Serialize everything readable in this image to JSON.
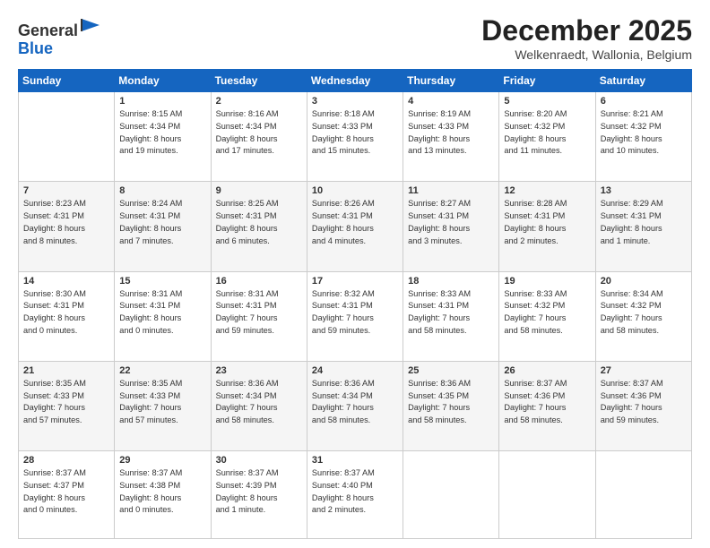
{
  "header": {
    "logo_line1": "General",
    "logo_line2": "Blue",
    "month": "December 2025",
    "location": "Welkenraedt, Wallonia, Belgium"
  },
  "weekdays": [
    "Sunday",
    "Monday",
    "Tuesday",
    "Wednesday",
    "Thursday",
    "Friday",
    "Saturday"
  ],
  "weeks": [
    [
      {
        "day": "",
        "info": ""
      },
      {
        "day": "1",
        "info": "Sunrise: 8:15 AM\nSunset: 4:34 PM\nDaylight: 8 hours\nand 19 minutes."
      },
      {
        "day": "2",
        "info": "Sunrise: 8:16 AM\nSunset: 4:34 PM\nDaylight: 8 hours\nand 17 minutes."
      },
      {
        "day": "3",
        "info": "Sunrise: 8:18 AM\nSunset: 4:33 PM\nDaylight: 8 hours\nand 15 minutes."
      },
      {
        "day": "4",
        "info": "Sunrise: 8:19 AM\nSunset: 4:33 PM\nDaylight: 8 hours\nand 13 minutes."
      },
      {
        "day": "5",
        "info": "Sunrise: 8:20 AM\nSunset: 4:32 PM\nDaylight: 8 hours\nand 11 minutes."
      },
      {
        "day": "6",
        "info": "Sunrise: 8:21 AM\nSunset: 4:32 PM\nDaylight: 8 hours\nand 10 minutes."
      }
    ],
    [
      {
        "day": "7",
        "info": "Sunrise: 8:23 AM\nSunset: 4:31 PM\nDaylight: 8 hours\nand 8 minutes."
      },
      {
        "day": "8",
        "info": "Sunrise: 8:24 AM\nSunset: 4:31 PM\nDaylight: 8 hours\nand 7 minutes."
      },
      {
        "day": "9",
        "info": "Sunrise: 8:25 AM\nSunset: 4:31 PM\nDaylight: 8 hours\nand 6 minutes."
      },
      {
        "day": "10",
        "info": "Sunrise: 8:26 AM\nSunset: 4:31 PM\nDaylight: 8 hours\nand 4 minutes."
      },
      {
        "day": "11",
        "info": "Sunrise: 8:27 AM\nSunset: 4:31 PM\nDaylight: 8 hours\nand 3 minutes."
      },
      {
        "day": "12",
        "info": "Sunrise: 8:28 AM\nSunset: 4:31 PM\nDaylight: 8 hours\nand 2 minutes."
      },
      {
        "day": "13",
        "info": "Sunrise: 8:29 AM\nSunset: 4:31 PM\nDaylight: 8 hours\nand 1 minute."
      }
    ],
    [
      {
        "day": "14",
        "info": "Sunrise: 8:30 AM\nSunset: 4:31 PM\nDaylight: 8 hours\nand 0 minutes."
      },
      {
        "day": "15",
        "info": "Sunrise: 8:31 AM\nSunset: 4:31 PM\nDaylight: 8 hours\nand 0 minutes."
      },
      {
        "day": "16",
        "info": "Sunrise: 8:31 AM\nSunset: 4:31 PM\nDaylight: 7 hours\nand 59 minutes."
      },
      {
        "day": "17",
        "info": "Sunrise: 8:32 AM\nSunset: 4:31 PM\nDaylight: 7 hours\nand 59 minutes."
      },
      {
        "day": "18",
        "info": "Sunrise: 8:33 AM\nSunset: 4:31 PM\nDaylight: 7 hours\nand 58 minutes."
      },
      {
        "day": "19",
        "info": "Sunrise: 8:33 AM\nSunset: 4:32 PM\nDaylight: 7 hours\nand 58 minutes."
      },
      {
        "day": "20",
        "info": "Sunrise: 8:34 AM\nSunset: 4:32 PM\nDaylight: 7 hours\nand 58 minutes."
      }
    ],
    [
      {
        "day": "21",
        "info": "Sunrise: 8:35 AM\nSunset: 4:33 PM\nDaylight: 7 hours\nand 57 minutes."
      },
      {
        "day": "22",
        "info": "Sunrise: 8:35 AM\nSunset: 4:33 PM\nDaylight: 7 hours\nand 57 minutes."
      },
      {
        "day": "23",
        "info": "Sunrise: 8:36 AM\nSunset: 4:34 PM\nDaylight: 7 hours\nand 58 minutes."
      },
      {
        "day": "24",
        "info": "Sunrise: 8:36 AM\nSunset: 4:34 PM\nDaylight: 7 hours\nand 58 minutes."
      },
      {
        "day": "25",
        "info": "Sunrise: 8:36 AM\nSunset: 4:35 PM\nDaylight: 7 hours\nand 58 minutes."
      },
      {
        "day": "26",
        "info": "Sunrise: 8:37 AM\nSunset: 4:36 PM\nDaylight: 7 hours\nand 58 minutes."
      },
      {
        "day": "27",
        "info": "Sunrise: 8:37 AM\nSunset: 4:36 PM\nDaylight: 7 hours\nand 59 minutes."
      }
    ],
    [
      {
        "day": "28",
        "info": "Sunrise: 8:37 AM\nSunset: 4:37 PM\nDaylight: 8 hours\nand 0 minutes."
      },
      {
        "day": "29",
        "info": "Sunrise: 8:37 AM\nSunset: 4:38 PM\nDaylight: 8 hours\nand 0 minutes."
      },
      {
        "day": "30",
        "info": "Sunrise: 8:37 AM\nSunset: 4:39 PM\nDaylight: 8 hours\nand 1 minute."
      },
      {
        "day": "31",
        "info": "Sunrise: 8:37 AM\nSunset: 4:40 PM\nDaylight: 8 hours\nand 2 minutes."
      },
      {
        "day": "",
        "info": ""
      },
      {
        "day": "",
        "info": ""
      },
      {
        "day": "",
        "info": ""
      }
    ]
  ]
}
